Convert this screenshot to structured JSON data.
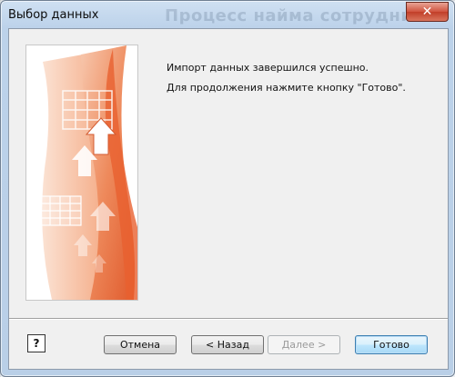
{
  "window": {
    "title": "Выбор данных",
    "close_symbol": "✕",
    "background_text": "Процесс найма сотрудников"
  },
  "message": {
    "line1": "Импорт данных завершился успешно.",
    "line2": "Для продолжения нажмите кнопку \"Готово\"."
  },
  "buttons": {
    "help": "?",
    "cancel": "Отмена",
    "back": "< Назад",
    "next": "Далее >",
    "finish": "Готово"
  },
  "colors": {
    "banner_orange": "#e8653a",
    "banner_light": "#f6b08e",
    "close_red": "#c84a33"
  }
}
